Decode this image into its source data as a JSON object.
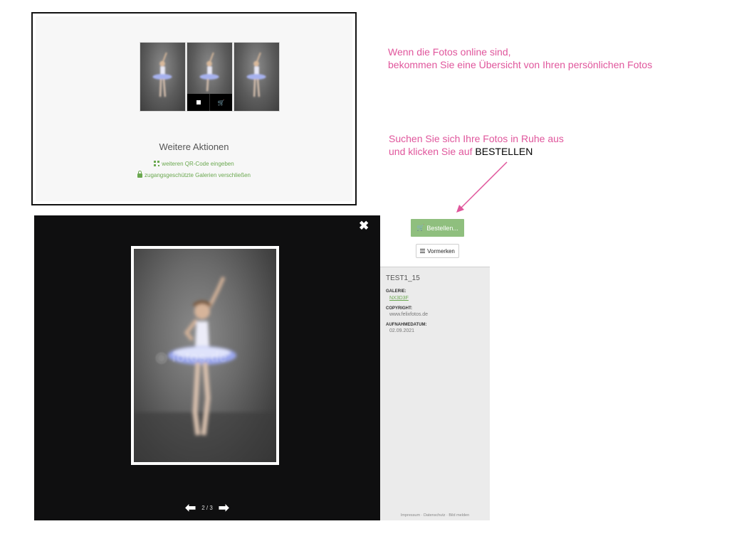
{
  "gallery": {
    "more_actions_title": "Weitere Aktionen",
    "qr_link": "weiteren QR-Code eingeben",
    "lock_link": "zugangsgeschützte Galerien verschließen"
  },
  "annotations": {
    "note1_line1": "Wenn die Fotos online sind,",
    "note1_line2": "bekommen Sie eine Übersicht von Ihren persönlichen Fotos",
    "note2_line1": "Suchen Sie sich Ihre Fotos in Ruhe aus",
    "note2_line2_prefix": "und klicken Sie auf ",
    "note2_line2_highlight": "BESTELLEN",
    "accent_color": "#e0569c"
  },
  "lightbox": {
    "close_glyph": "✖",
    "prev_glyph": "⬅",
    "next_glyph": "➡",
    "counter": "2 / 3"
  },
  "panel": {
    "order_button": "Bestellen...",
    "remember_button": "Vormerken",
    "image_name": "TEST1_15",
    "gallery_label": "GALERIE:",
    "gallery_value": "NX3D3F",
    "copyright_label": "COPYRIGHT:",
    "copyright_value": "www.felixfotos.de",
    "date_label": "AUFNAHMEDATUM:",
    "date_value": "02.09.2021",
    "footer_impressum": "Impressum",
    "footer_datenschutz": "Datenschutz",
    "footer_report": "Bild melden",
    "accent_green": "#8fbf7e"
  }
}
